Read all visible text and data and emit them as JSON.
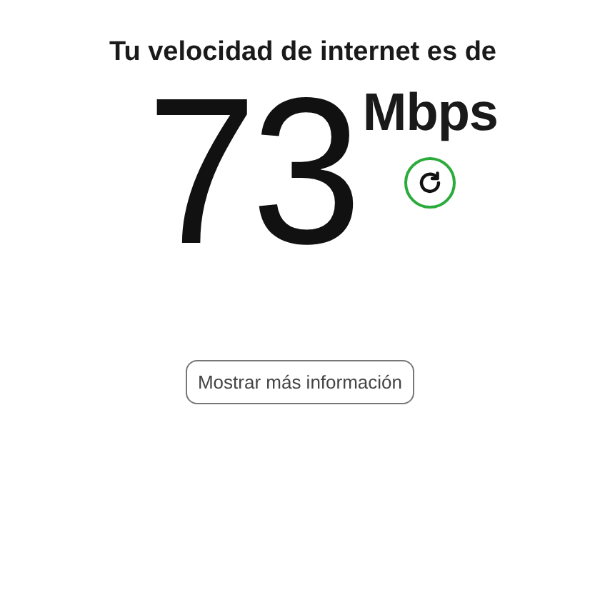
{
  "heading": "Tu velocidad de internet es de",
  "speed": {
    "value": "73",
    "unit": "Mbps"
  },
  "more_info_button": {
    "label": "Mostrar más información"
  }
}
